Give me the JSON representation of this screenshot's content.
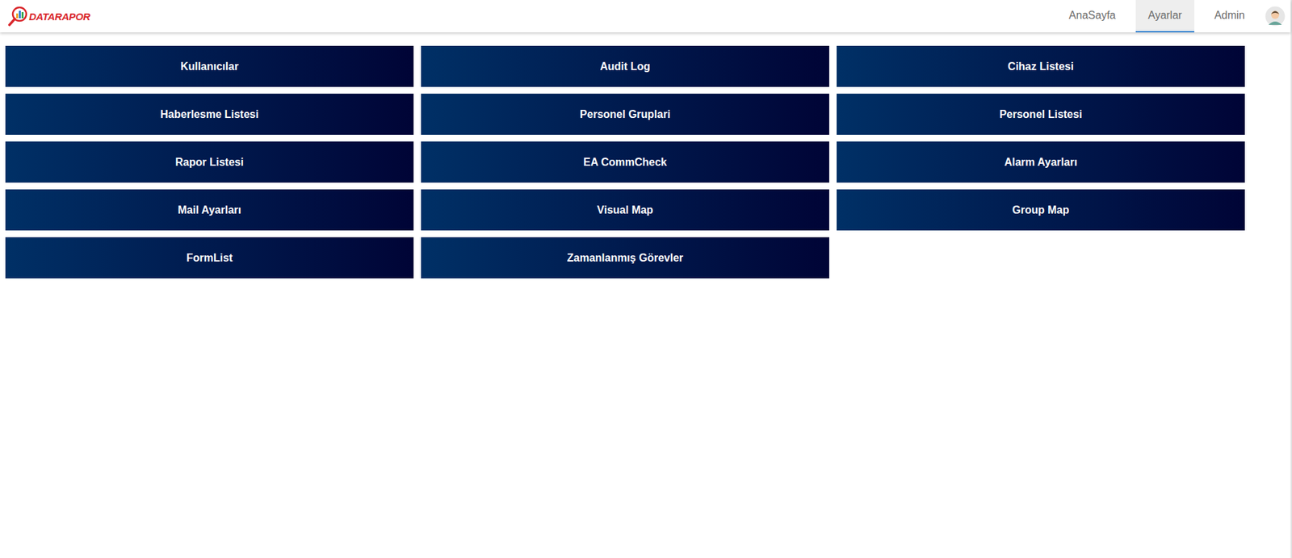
{
  "header": {
    "logo": "DATARAPOR",
    "nav": [
      {
        "label": "AnaSayfa",
        "selected": false
      },
      {
        "label": "Ayarlar",
        "selected": true
      },
      {
        "label": "Admin",
        "selected": false
      }
    ]
  },
  "tiles": [
    "Kullanıcılar",
    "Audit Log",
    "Cihaz Listesi",
    "Haberlesme Listesi",
    "Personel Gruplari",
    "Personel Listesi",
    "Rapor Listesi",
    "EA CommCheck",
    "Alarm Ayarları",
    "Mail Ayarları",
    "Visual Map",
    "Group Map",
    "FormList",
    "Zamanlanmış Görevler"
  ]
}
